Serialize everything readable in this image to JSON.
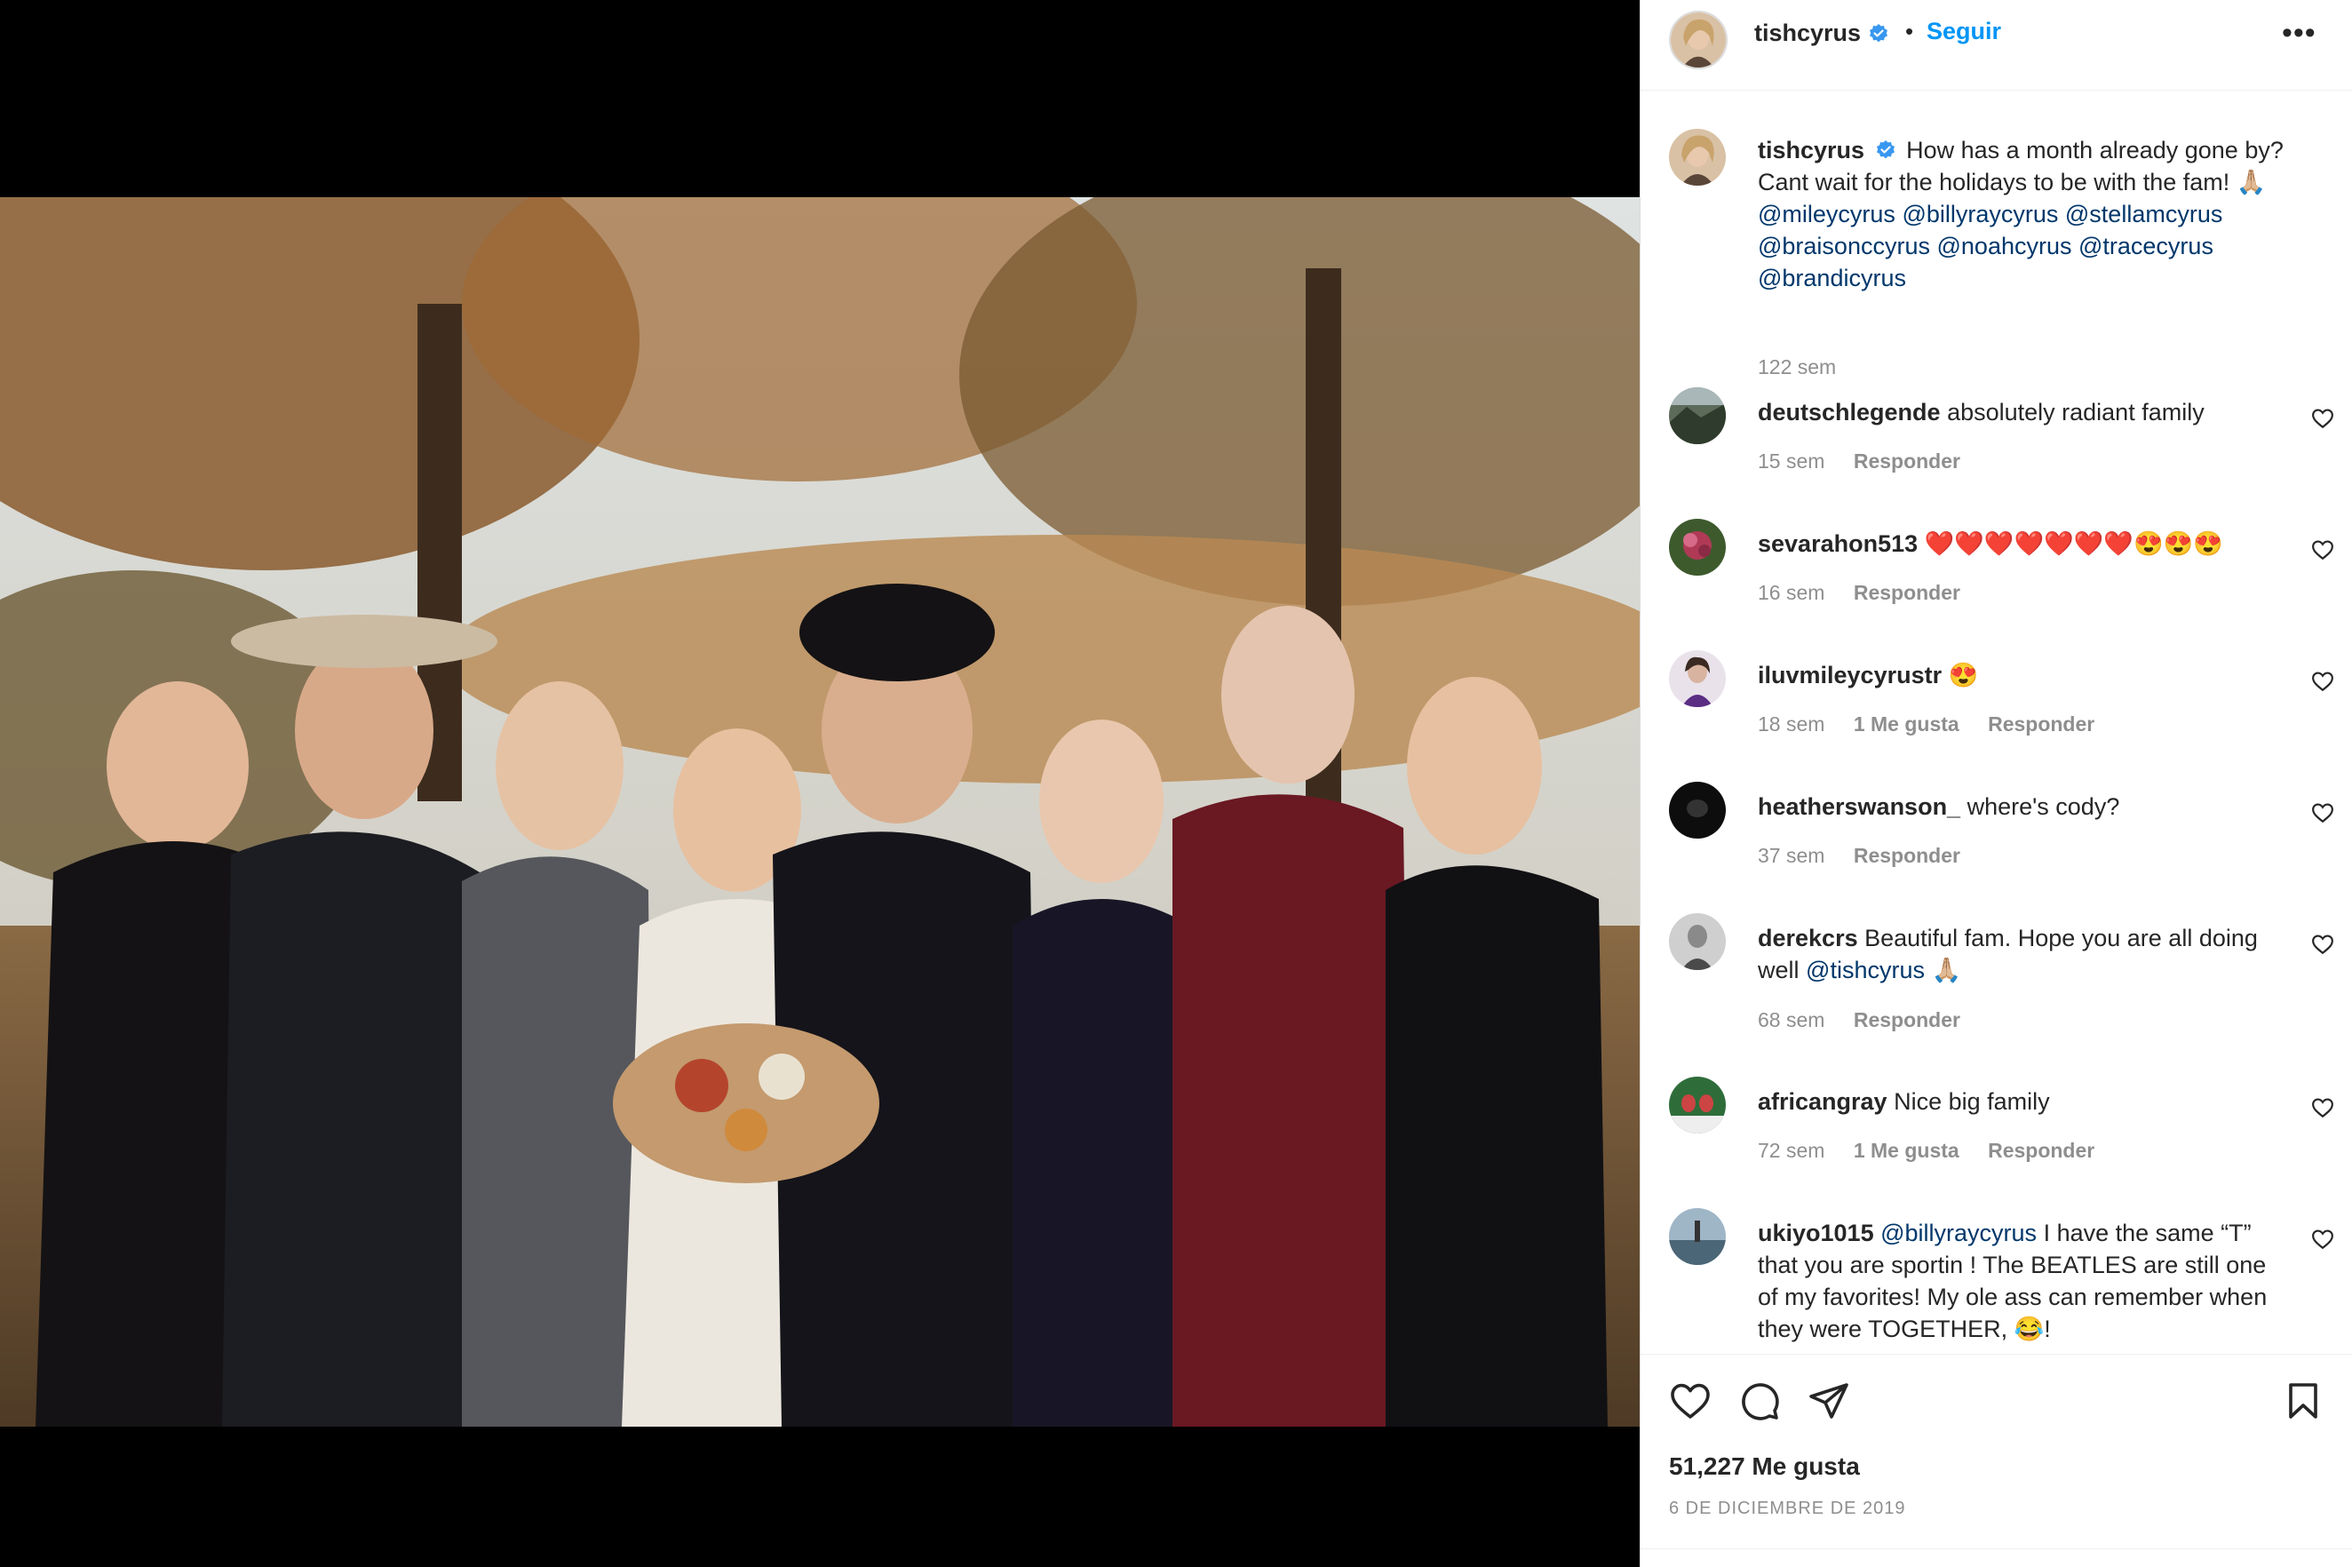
{
  "post": {
    "username": "tishcyrus",
    "follow_label": "Seguir",
    "dot": "•",
    "more_label": "•••"
  },
  "caption": {
    "username": "tishcyrus",
    "text": "How has a month already gone by? Cant wait for the holidays to be with the fam! 🙏🏼",
    "mentions": [
      "@mileycyrus",
      "@billyraycyrus",
      "@stellamcyrus",
      "@braisonccyrus",
      "@noahcyrus",
      "@tracecyrus",
      "@brandicyrus"
    ],
    "time": "122 sem"
  },
  "comments": [
    {
      "username": "deutschlegende",
      "text": "absolutely radiant family",
      "time": "15 sem",
      "likes": "",
      "reply": "Responder"
    },
    {
      "username": "sevarahon513",
      "text": "❤️❤️❤️❤️❤️❤️❤️😍😍😍",
      "time": "16 sem",
      "likes": "",
      "reply": "Responder"
    },
    {
      "username": "iluvmileycyrustr",
      "text": "😍",
      "time": "18 sem",
      "likes": "1 Me gusta",
      "reply": "Responder"
    },
    {
      "username": "heatherswanson_",
      "text": "where's cody?",
      "time": "37 sem",
      "likes": "",
      "reply": "Responder"
    },
    {
      "username": "derekcrs",
      "text": "Beautiful fam. Hope you are all doing well",
      "mention": "@tishcyrus",
      "tail": " 🙏🏼",
      "time": "68 sem",
      "likes": "",
      "reply": "Responder"
    },
    {
      "username": "africangray",
      "text": "Nice big family",
      "time": "72 sem",
      "likes": "1 Me gusta",
      "reply": "Responder"
    },
    {
      "username": "ukiyo1015",
      "mention": "@billyraycyrus",
      "text": "I have the same “T” that you are sportin ! The BEATLES are still one of my favorites! My ole ass can remember when they were TOGETHER, 😂!"
    }
  ],
  "footer": {
    "likes": "51,227 Me gusta",
    "date": "6 DE DICIEMBRE DE 2019"
  },
  "colors": {
    "accent": "#0095f6",
    "mention": "#00376b",
    "muted": "#8e8e8e",
    "verified": "#3897f0"
  }
}
